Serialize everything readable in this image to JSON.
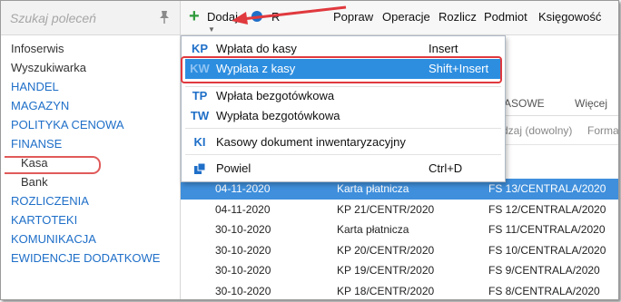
{
  "sidebar": {
    "search_placeholder": "Szukaj poleceń",
    "items": [
      {
        "label": "Infoserwis",
        "kind": "plain"
      },
      {
        "label": "Wyszukiwarka",
        "kind": "plain"
      },
      {
        "label": "HANDEL",
        "kind": "cat"
      },
      {
        "label": "MAGAZYN",
        "kind": "cat"
      },
      {
        "label": "POLITYKA CENOWA",
        "kind": "cat"
      },
      {
        "label": "FINANSE",
        "kind": "cat"
      },
      {
        "label": "Kasa",
        "kind": "sub"
      },
      {
        "label": "Bank",
        "kind": "sub"
      },
      {
        "label": "ROZLICZENIA",
        "kind": "cat"
      },
      {
        "label": "KARTOTEKI",
        "kind": "cat"
      },
      {
        "label": "KOMUNIKACJA",
        "kind": "cat"
      },
      {
        "label": "EWIDENCJE DODATKOWE",
        "kind": "cat"
      }
    ]
  },
  "toolbar": {
    "add": "Dodaj",
    "print_partial": "R",
    "fix": "Popraw",
    "operations": "Operacje",
    "settle": "Rozlicz",
    "subject": "Podmiot",
    "accounting": "Księgowość"
  },
  "tabs": {
    "partial": "ASOWE",
    "more": "Więcej"
  },
  "filter": {
    "kind_any": "dzaj (dowolny)",
    "form": "Forma"
  },
  "menu": {
    "items": [
      {
        "badge": "KP",
        "label": "Wpłata do kasy",
        "shortcut": "Insert"
      },
      {
        "badge": "KW",
        "label": "Wypłata z kasy",
        "shortcut": "Shift+Insert"
      },
      {
        "badge": "TP",
        "label": "Wpłata bezgotówkowa",
        "shortcut": ""
      },
      {
        "badge": "TW",
        "label": "Wypłata bezgotówkowa",
        "shortcut": ""
      },
      {
        "badge": "KI",
        "label": "Kasowy dokument inwentaryzacyjny",
        "shortcut": ""
      },
      {
        "badge": "",
        "label": "Powiel",
        "shortcut": "Ctrl+D"
      }
    ]
  },
  "table": {
    "rows": [
      {
        "date": "04-11-2020",
        "doc": "Karta płatnicza",
        "ref": "FS 13/CENTRALA/2020",
        "selected": true
      },
      {
        "date": "04-11-2020",
        "doc": "KP 21/CENTR/2020",
        "ref": "FS 12/CENTRALA/2020",
        "selected": false
      },
      {
        "date": "30-10-2020",
        "doc": "Karta płatnicza",
        "ref": "FS 11/CENTRALA/2020",
        "selected": false
      },
      {
        "date": "30-10-2020",
        "doc": "KP 20/CENTR/2020",
        "ref": "FS 10/CENTRALA/2020",
        "selected": false
      },
      {
        "date": "30-10-2020",
        "doc": "KP 19/CENTR/2020",
        "ref": "FS 9/CENTRALA/2020",
        "selected": false
      },
      {
        "date": "30-10-2020",
        "doc": "KP 18/CENTR/2020",
        "ref": "FS 8/CENTRALA/2020",
        "selected": false
      }
    ]
  },
  "colors": {
    "accent": "#1f6fc8",
    "highlight": "#2d8ee0",
    "annotation": "#e0393e",
    "add_icon": "#2e9a3a"
  }
}
